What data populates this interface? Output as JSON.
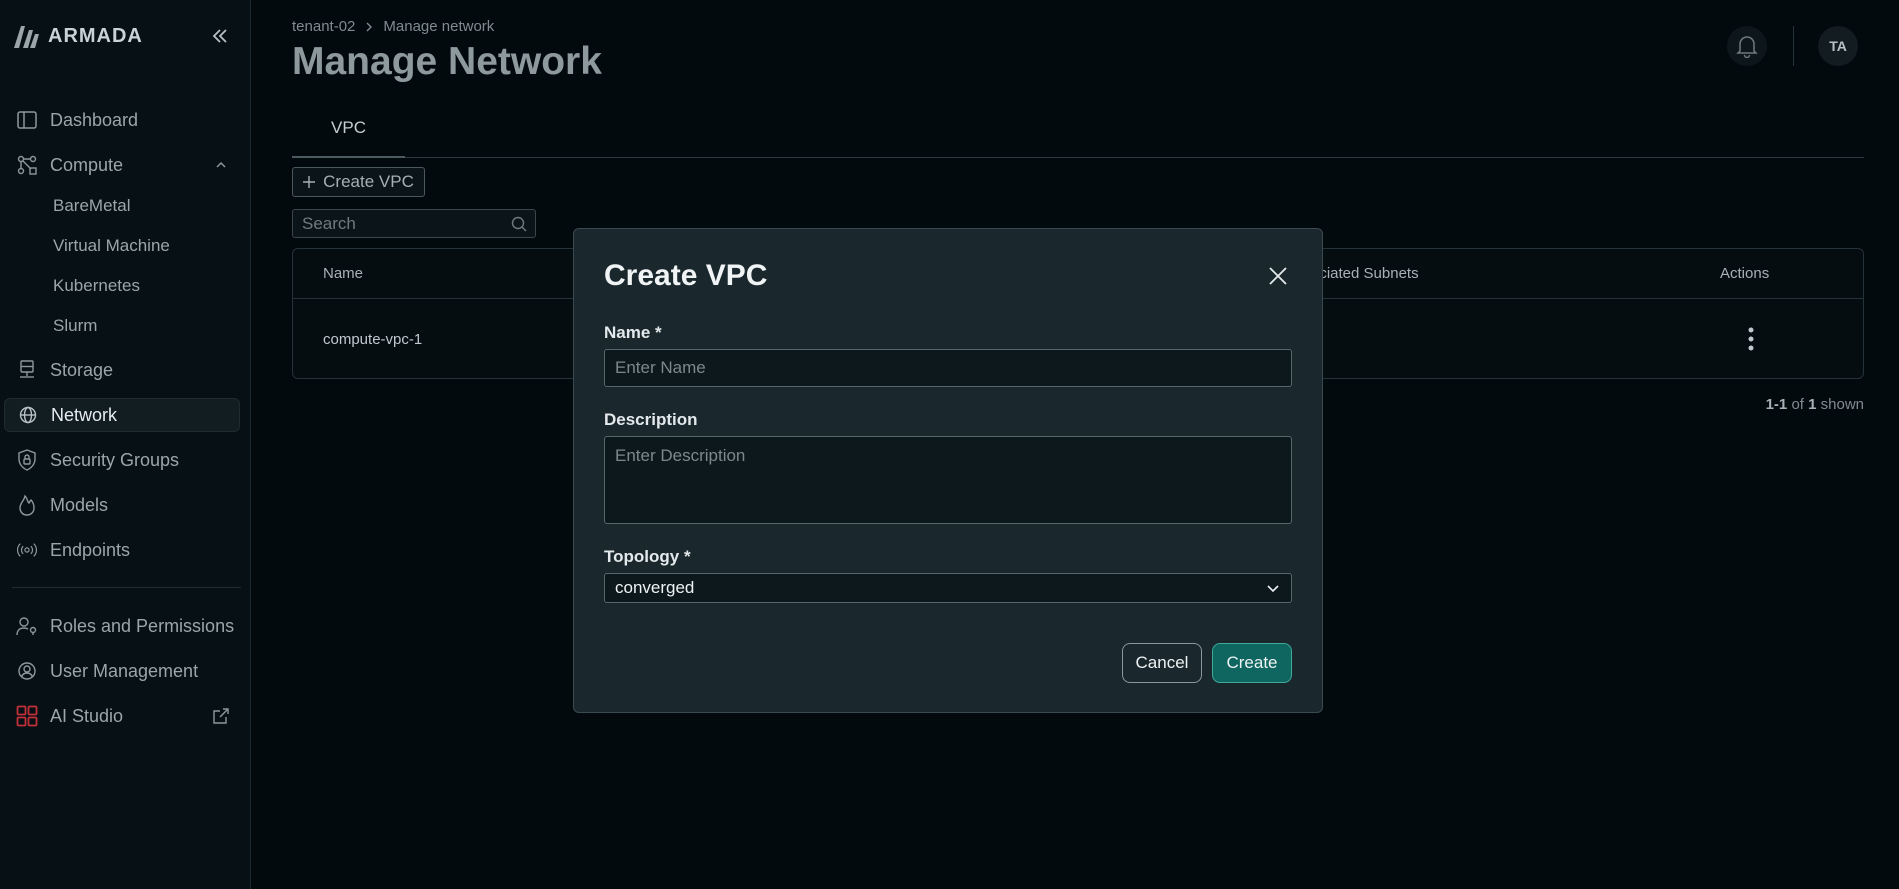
{
  "brand": {
    "name": "ARMADA"
  },
  "sidebar": {
    "items": [
      {
        "label": "Dashboard"
      },
      {
        "label": "Compute"
      },
      {
        "label": "BareMetal"
      },
      {
        "label": "Virtual Machine"
      },
      {
        "label": "Kubernetes"
      },
      {
        "label": "Slurm"
      },
      {
        "label": "Storage"
      },
      {
        "label": "Network"
      },
      {
        "label": "Security Groups"
      },
      {
        "label": "Models"
      },
      {
        "label": "Endpoints"
      },
      {
        "label": "Roles and Permissions"
      },
      {
        "label": "User Management"
      },
      {
        "label": "AI Studio"
      }
    ]
  },
  "header": {
    "breadcrumb": [
      "tenant-02",
      "Manage network"
    ],
    "title": "Manage Network",
    "avatar_initials": "TA"
  },
  "tabs": [
    {
      "label": "VPC"
    }
  ],
  "toolbar": {
    "create_label": "Create VPC",
    "search_placeholder": "Search"
  },
  "table": {
    "columns": {
      "name": "Name",
      "subnets": "ociated Subnets",
      "actions": "Actions"
    },
    "rows": [
      {
        "name": "compute-vpc-1"
      }
    ]
  },
  "pagination": {
    "range": "1-1",
    "of": "of",
    "total": "1",
    "suffix": "shown"
  },
  "modal": {
    "title": "Create VPC",
    "name_label": "Name *",
    "name_placeholder": "Enter Name",
    "description_label": "Description",
    "description_placeholder": "Enter Description",
    "topology_label": "Topology *",
    "topology_value": "converged",
    "cancel_label": "Cancel",
    "create_label": "Create"
  },
  "colors": {
    "background": "#030a0d",
    "modal": "#1a282e",
    "primary": "#0f6660",
    "ai_studio_icon": "#c0303a"
  }
}
